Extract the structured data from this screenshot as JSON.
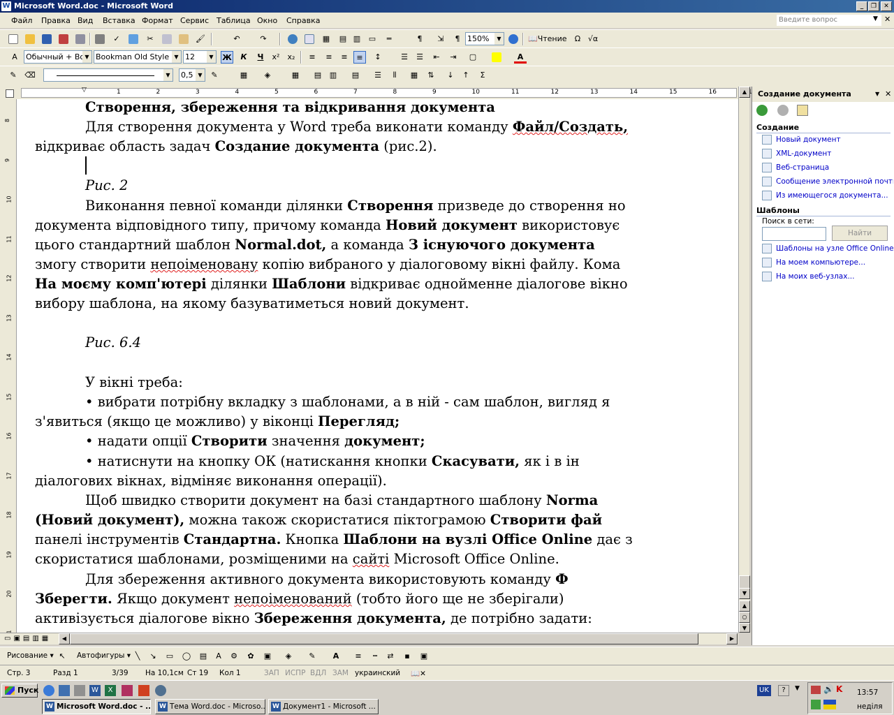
{
  "window": {
    "title": "Microsoft Word.doc - Microsoft Word"
  },
  "menu": {
    "items": [
      "Файл",
      "Правка",
      "Вид",
      "Вставка",
      "Формат",
      "Сервис",
      "Таблица",
      "Окно",
      "Справка"
    ],
    "ask_placeholder": "Введите вопрос"
  },
  "toolbar_standard": {
    "zoom": "150%",
    "read_label": "Чтение"
  },
  "toolbar_format": {
    "style": "Обычный + Boo",
    "font": "Bookman Old Style",
    "size": "12",
    "bold": "Ж",
    "italic": "К",
    "underline": "Ч"
  },
  "toolbar_tables": {
    "line_weight": "0,5"
  },
  "ruler": {
    "h_ticks": [
      "1",
      "2",
      "3",
      "4",
      "5",
      "6",
      "7",
      "8",
      "9",
      "10",
      "11",
      "12",
      "13",
      "14",
      "15",
      "16",
      "17"
    ],
    "v_ticks": [
      "8",
      "9",
      "10",
      "11",
      "12",
      "13",
      "14",
      "15",
      "16",
      "17",
      "18",
      "19",
      "20",
      "21"
    ]
  },
  "document": {
    "lines": {
      "l1": "Створення, збереження та відкривання документа",
      "l2a": "Для створення документа у Word треба виконати команду ",
      "l2b": "Файл/Создать,",
      "l3a": "відкриває область задач ",
      "l3b": "Создание документа",
      "l3c": " (рис.2).",
      "fig2": "Рис. 2",
      "l5a": "Виконання певної команди ділянки ",
      "l5b": "Створення",
      "l5c": " призведе до створення но",
      "l6a": "документа відповідного типу, причому команда ",
      "l6b": "Новий документ",
      "l6c": " використовує",
      "l7a": "цього стандартний шаблон ",
      "l7b": "Normal.dot,",
      "l7c": " а команда ",
      "l7d": "З існуючого документа",
      "l8a": "змогу створити ",
      "l8b": "непоіменовану",
      "l8c": " копію вибраного у діалоговому вікні файлу. Кома",
      "l9a": "На моєму комп'ютері",
      "l9b": " ділянки ",
      "l9c": "Шаблони",
      "l9d": " відкриває однойменне діалогове вікно",
      "l10": "вибору шаблона, на якому базуватиметься новий документ.",
      "fig64": "Рис. 6.4",
      "l12": "У вікні треба:",
      "l13": "•  вибрати потрібну вкладку з шаблонами, а в ній - сам шаблон, вигляд я",
      "l14a": "з'явиться (якщо це можливо) у віконці ",
      "l14b": "Перегляд;",
      "l15a": "• надати опції ",
      "l15b": "Створити",
      "l15c": " значення ",
      "l15d": "документ;",
      "l16a": "• натиснути на кнопку ОК (натискання кнопки ",
      "l16b": "Скасувати,",
      "l16c": " як і в ін",
      "l17": "діалогових вікнах, відміняє виконання операції).",
      "l18a": "Щоб швидко створити документ на базі стандартного шаблону ",
      "l18b": "Norma",
      "l19a": "(Новий документ),",
      "l19b": " можна також скористатися піктограмою ",
      "l19c": "Створити фай",
      "l20a": "панелі інструментів ",
      "l20b": "Стандартна.",
      "l20c": " Кнопка ",
      "l20d": "Шаблони на вузлі Office Online",
      "l20e": " дає з",
      "l21a": "скористатися шаблонами, розміщеними на ",
      "l21b": "сайті",
      "l21c": " Microsoft Office Online.",
      "l22a": "Для збереження активного документа використовують команду ",
      "l22b": "Ф",
      "l23a": "Зберегти.",
      "l23b": " Якщо документ ",
      "l23c": "непоіменований",
      "l23d": " (тобто його ще не зберігали)",
      "l24a": "активізується діалогове вікно ",
      "l24b": "Збереження документа,",
      "l24c": " де потрібно задати:"
    }
  },
  "taskpane": {
    "title": "Создание документа",
    "section_create": "Создание",
    "create_links": [
      "Новый документ",
      "XML-документ",
      "Веб-страница",
      "Сообщение электронной почты",
      "Из имеющегося документа..."
    ],
    "section_templates": "Шаблоны",
    "search_label": "Поиск в сети:",
    "search_button": "Найти",
    "template_links": [
      "Шаблоны на узле Office Online",
      "На моем компьютере...",
      "На моих веб-узлах..."
    ]
  },
  "drawbar": {
    "drawing": "Рисование",
    "autoshapes": "Автофигуры"
  },
  "status": {
    "page": "Стр. 3",
    "section": "Разд 1",
    "pages": "3/39",
    "at": "На 10,1см",
    "line": "Ст 19",
    "col": "Кол 1",
    "rec": "ЗАП",
    "trk": "ИСПР",
    "ext": "ВДЛ",
    "ovr": "ЗАМ",
    "lang": "украинский"
  },
  "taskbar": {
    "start": "Пуск",
    "tasks": [
      "Microsoft Word.doc - ...",
      "Тема Word.doc - Microso...",
      "Документ1 - Microsoft ..."
    ],
    "lang": "UK",
    "time": "13:57",
    "day": "неділя"
  }
}
